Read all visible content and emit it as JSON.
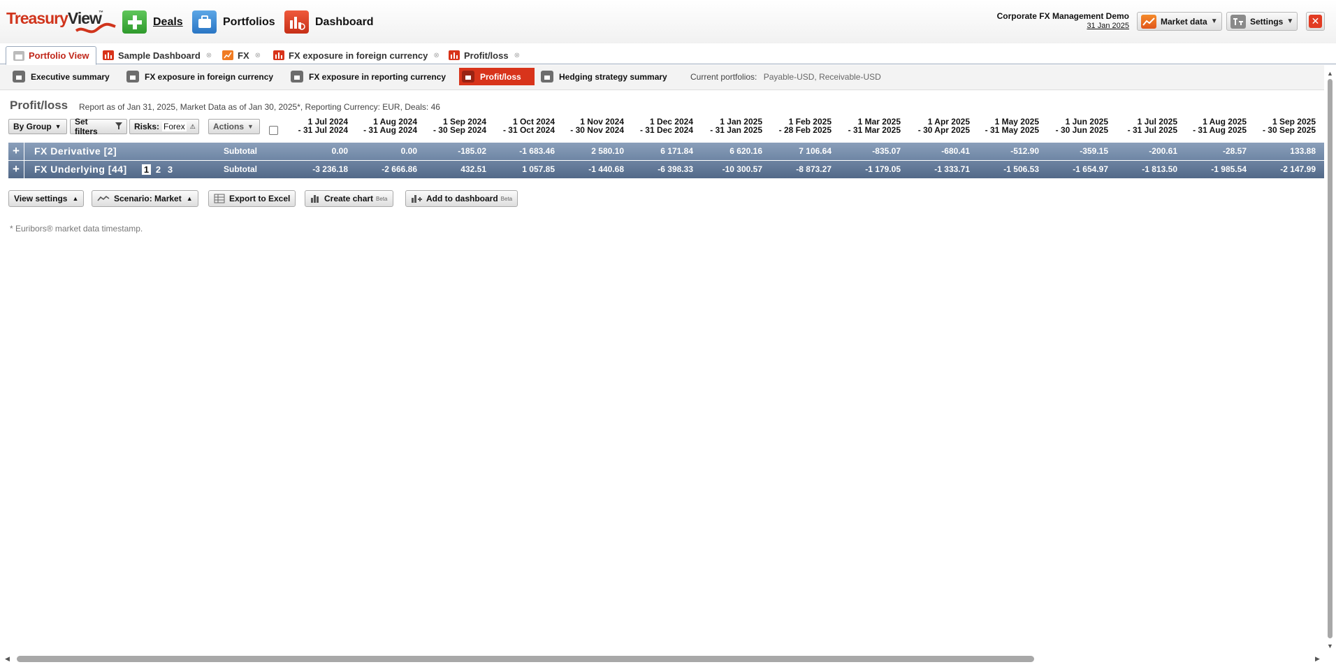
{
  "brand": {
    "logo_part1": "Treasury",
    "logo_part2": "View",
    "logo_tm": "™"
  },
  "nav": {
    "deals": "Deals",
    "portfolios": "Portfolios",
    "dashboard": "Dashboard"
  },
  "org": {
    "name": "Corporate FX Management Demo",
    "date": "31 Jan 2025"
  },
  "header_buttons": {
    "market_data": "Market data",
    "settings": "Settings"
  },
  "tabs": [
    {
      "label": "Portfolio View",
      "icon": "briefcase-icon",
      "active": true
    },
    {
      "label": "Sample Dashboard",
      "icon": "bar-chart-icon"
    },
    {
      "label": "FX",
      "icon": "line-chart-icon"
    },
    {
      "label": "FX exposure in foreign currency",
      "icon": "bar-chart-icon"
    },
    {
      "label": "Profit/loss",
      "icon": "bar-chart-icon"
    }
  ],
  "subtabs": [
    {
      "label": "Executive summary"
    },
    {
      "label": "FX exposure in foreign currency"
    },
    {
      "label": "FX exposure in reporting currency"
    },
    {
      "label": "Profit/loss",
      "active": true
    },
    {
      "label": "Hedging strategy summary"
    }
  ],
  "current_portfolios": {
    "label": "Current portfolios:",
    "value": "Payable-USD, Receivable-USD"
  },
  "report": {
    "title": "Profit/loss",
    "info": "Report as of Jan 31, 2025, Market Data as of Jan 30, 2025*, Reporting Currency: EUR, Deals: 46"
  },
  "controls": {
    "by_group": "By Group",
    "set_filters": "Set filters",
    "risks_label": "Risks:",
    "risks_value": "Forex",
    "actions": "Actions"
  },
  "columns": [
    {
      "l1": "1 Jul 2024",
      "l2": "- 31 Jul 2024"
    },
    {
      "l1": "1 Aug 2024",
      "l2": "- 31 Aug 2024"
    },
    {
      "l1": "1 Sep 2024",
      "l2": "- 30 Sep 2024"
    },
    {
      "l1": "1 Oct 2024",
      "l2": "- 31 Oct 2024"
    },
    {
      "l1": "1 Nov 2024",
      "l2": "- 30 Nov 2024"
    },
    {
      "l1": "1 Dec 2024",
      "l2": "- 31 Dec 2024"
    },
    {
      "l1": "1 Jan 2025",
      "l2": "- 31 Jan 2025"
    },
    {
      "l1": "1 Feb 2025",
      "l2": "- 28 Feb 2025"
    },
    {
      "l1": "1 Mar 2025",
      "l2": "- 31 Mar 2025"
    },
    {
      "l1": "1 Apr 2025",
      "l2": "- 30 Apr 2025"
    },
    {
      "l1": "1 May 2025",
      "l2": "- 31 May 2025"
    },
    {
      "l1": "1 Jun 2025",
      "l2": "- 30 Jun 2025"
    },
    {
      "l1": "1 Jul 2025",
      "l2": "- 31 Jul 2025"
    },
    {
      "l1": "1 Aug 2025",
      "l2": "- 31 Aug 2025"
    },
    {
      "l1": "1 Sep 2025",
      "l2": "- 30 Sep 2025"
    }
  ],
  "rows": [
    {
      "expand": "+",
      "group": "FX Derivative [2]",
      "subtotal": "Subtotal",
      "values": [
        "0.00",
        "0.00",
        "-185.02",
        "-1 683.46",
        "2 580.10",
        "6 171.84",
        "6 620.16",
        "7 106.64",
        "-835.07",
        "-680.41",
        "-512.90",
        "-359.15",
        "-200.61",
        "-28.57",
        "133.88"
      ]
    },
    {
      "expand": "+",
      "group": "FX Underlying [44]",
      "pages": [
        "1",
        "2",
        "3"
      ],
      "subtotal": "Subtotal",
      "values": [
        "-3 236.18",
        "-2 666.86",
        "432.51",
        "1 057.85",
        "-1 440.68",
        "-6 398.33",
        "-10 300.57",
        "-8 873.27",
        "-1 179.05",
        "-1 333.71",
        "-1 506.53",
        "-1 654.97",
        "-1 813.50",
        "-1 985.54",
        "-2 147.99"
      ]
    }
  ],
  "bottom_buttons": {
    "view_settings": "View settings",
    "scenario": "Scenario: Market",
    "export_excel": "Export to Excel",
    "create_chart": "Create chart",
    "add_dashboard": "Add to dashboard",
    "beta": "Beta"
  },
  "footnote": "* Euribors® market data timestamp.",
  "colors": {
    "accent_red": "#d8341b",
    "grid_row_1": "#7d93b0",
    "grid_row_2": "#5f7696"
  }
}
